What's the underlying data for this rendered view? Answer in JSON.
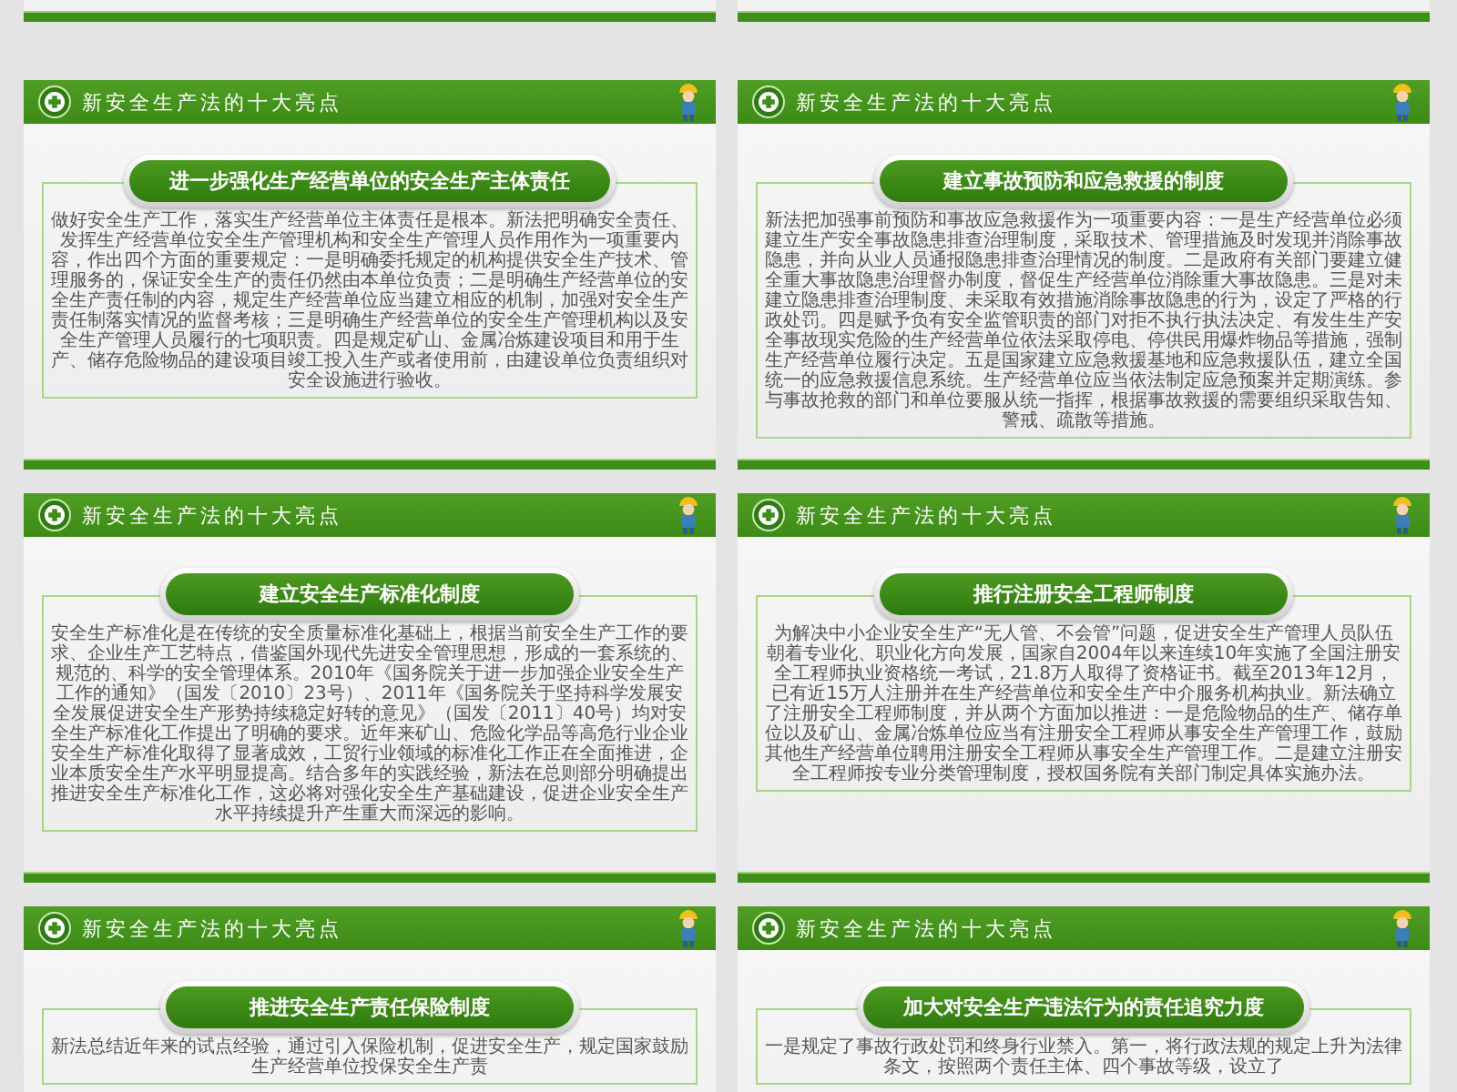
{
  "slides": [
    {
      "header": "新安全生产法的十大亮点",
      "heading": "进一步强化生产经营单位的安全生产主体责任",
      "body": "做好安全生产工作，落实生产经营单位主体责任是根本。新法把明确安全责任、发挥生产经营单位安全生产管理机构和安全生产管理人员作用作为一项重要内容，作出四个方面的重要规定：一是明确委托规定的机构提供安全生产技术、管理服务的，保证安全生产的责任仍然由本单位负责；二是明确生产经营单位的安全生产责任制的内容，规定生产经营单位应当建立相应的机制，加强对安全生产责任制落实情况的监督考核；三是明确生产经营单位的安全生产管理机构以及安全生产管理人员履行的七项职责。四是规定矿山、金属冶炼建设项目和用于生产、储存危险物品的建设项目竣工投入生产或者使用前，由建设单位负责组织对安全设施进行验收。"
    },
    {
      "header": "新安全生产法的十大亮点",
      "heading": "建立事故预防和应急救援的制度",
      "body": "新法把加强事前预防和事故应急救援作为一项重要内容：一是生产经营单位必须建立生产安全事故隐患排查治理制度，采取技术、管理措施及时发现并消除事故隐患，并向从业人员通报隐患排查治理情况的制度。二是政府有关部门要建立健全重大事故隐患治理督办制度，督促生产经营单位消除重大事故隐患。三是对未建立隐患排查治理制度、未采取有效措施消除事故隐患的行为，设定了严格的行政处罚。四是赋予负有安全监管职责的部门对拒不执行执法决定、有发生生产安全事故现实危险的生产经营单位依法采取停电、停供民用爆炸物品等措施，强制生产经营单位履行决定。五是国家建立应急救援基地和应急救援队伍，建立全国统一的应急救援信息系统。生产经营单位应当依法制定应急预案并定期演练。参与事故抢救的部门和单位要服从统一指挥，根据事故救援的需要组织采取告知、警戒、疏散等措施。"
    },
    {
      "header": "新安全生产法的十大亮点",
      "heading": "建立安全生产标准化制度",
      "body": "安全生产标准化是在传统的安全质量标准化基础上，根据当前安全生产工作的要求、企业生产工艺特点，借鉴国外现代先进安全管理思想，形成的一套系统的、规范的、科学的安全管理体系。2010年《国务院关于进一步加强企业安全生产工作的通知》（国发〔2010〕23号）、2011年《国务院关于坚持科学发展安全发展促进安全生产形势持续稳定好转的意见》（国发〔2011〕40号）均对安全生产标准化工作提出了明确的要求。近年来矿山、危险化学品等高危行业企业安全生产标准化取得了显著成效，工贸行业领域的标准化工作正在全面推进，企业本质安全生产水平明显提高。结合多年的实践经验，新法在总则部分明确提出推进安全生产标准化工作，这必将对强化安全生产基础建设，促进企业安全生产水平持续提升产生重大而深远的影响。"
    },
    {
      "header": "新安全生产法的十大亮点",
      "heading": "推行注册安全工程师制度",
      "body": "为解决中小企业安全生产“无人管、不会管”问题，促进安全生产管理人员队伍朝着专业化、职业化方向发展，国家自2004年以来连续10年实施了全国注册安全工程师执业资格统一考试，21.8万人取得了资格证书。截至2013年12月，已有近15万人注册并在生产经营单位和安全生产中介服务机构执业。新法确立了注册安全工程师制度，并从两个方面加以推进：一是危险物品的生产、储存单位以及矿山、金属冶炼单位应当有注册安全工程师从事安全生产管理工作，鼓励其他生产经营单位聘用注册安全工程师从事安全生产管理工作。二是建立注册安全工程师按专业分类管理制度，授权国务院有关部门制定具体实施办法。"
    },
    {
      "header": "新安全生产法的十大亮点",
      "heading": "推进安全生产责任保险制度",
      "body": "新法总结近年来的试点经验，通过引入保险机制，促进安全生产，规定国家鼓励生产经营单位投保安全生产责"
    },
    {
      "header": "新安全生产法的十大亮点",
      "heading": "加大对安全生产违法行为的责任追究力度",
      "body": "一是规定了事故行政处罚和终身行业禁入。第一，将行政法规的规定上升为法律条文，按照两个责任主体、四个事故等级，设立了"
    }
  ]
}
